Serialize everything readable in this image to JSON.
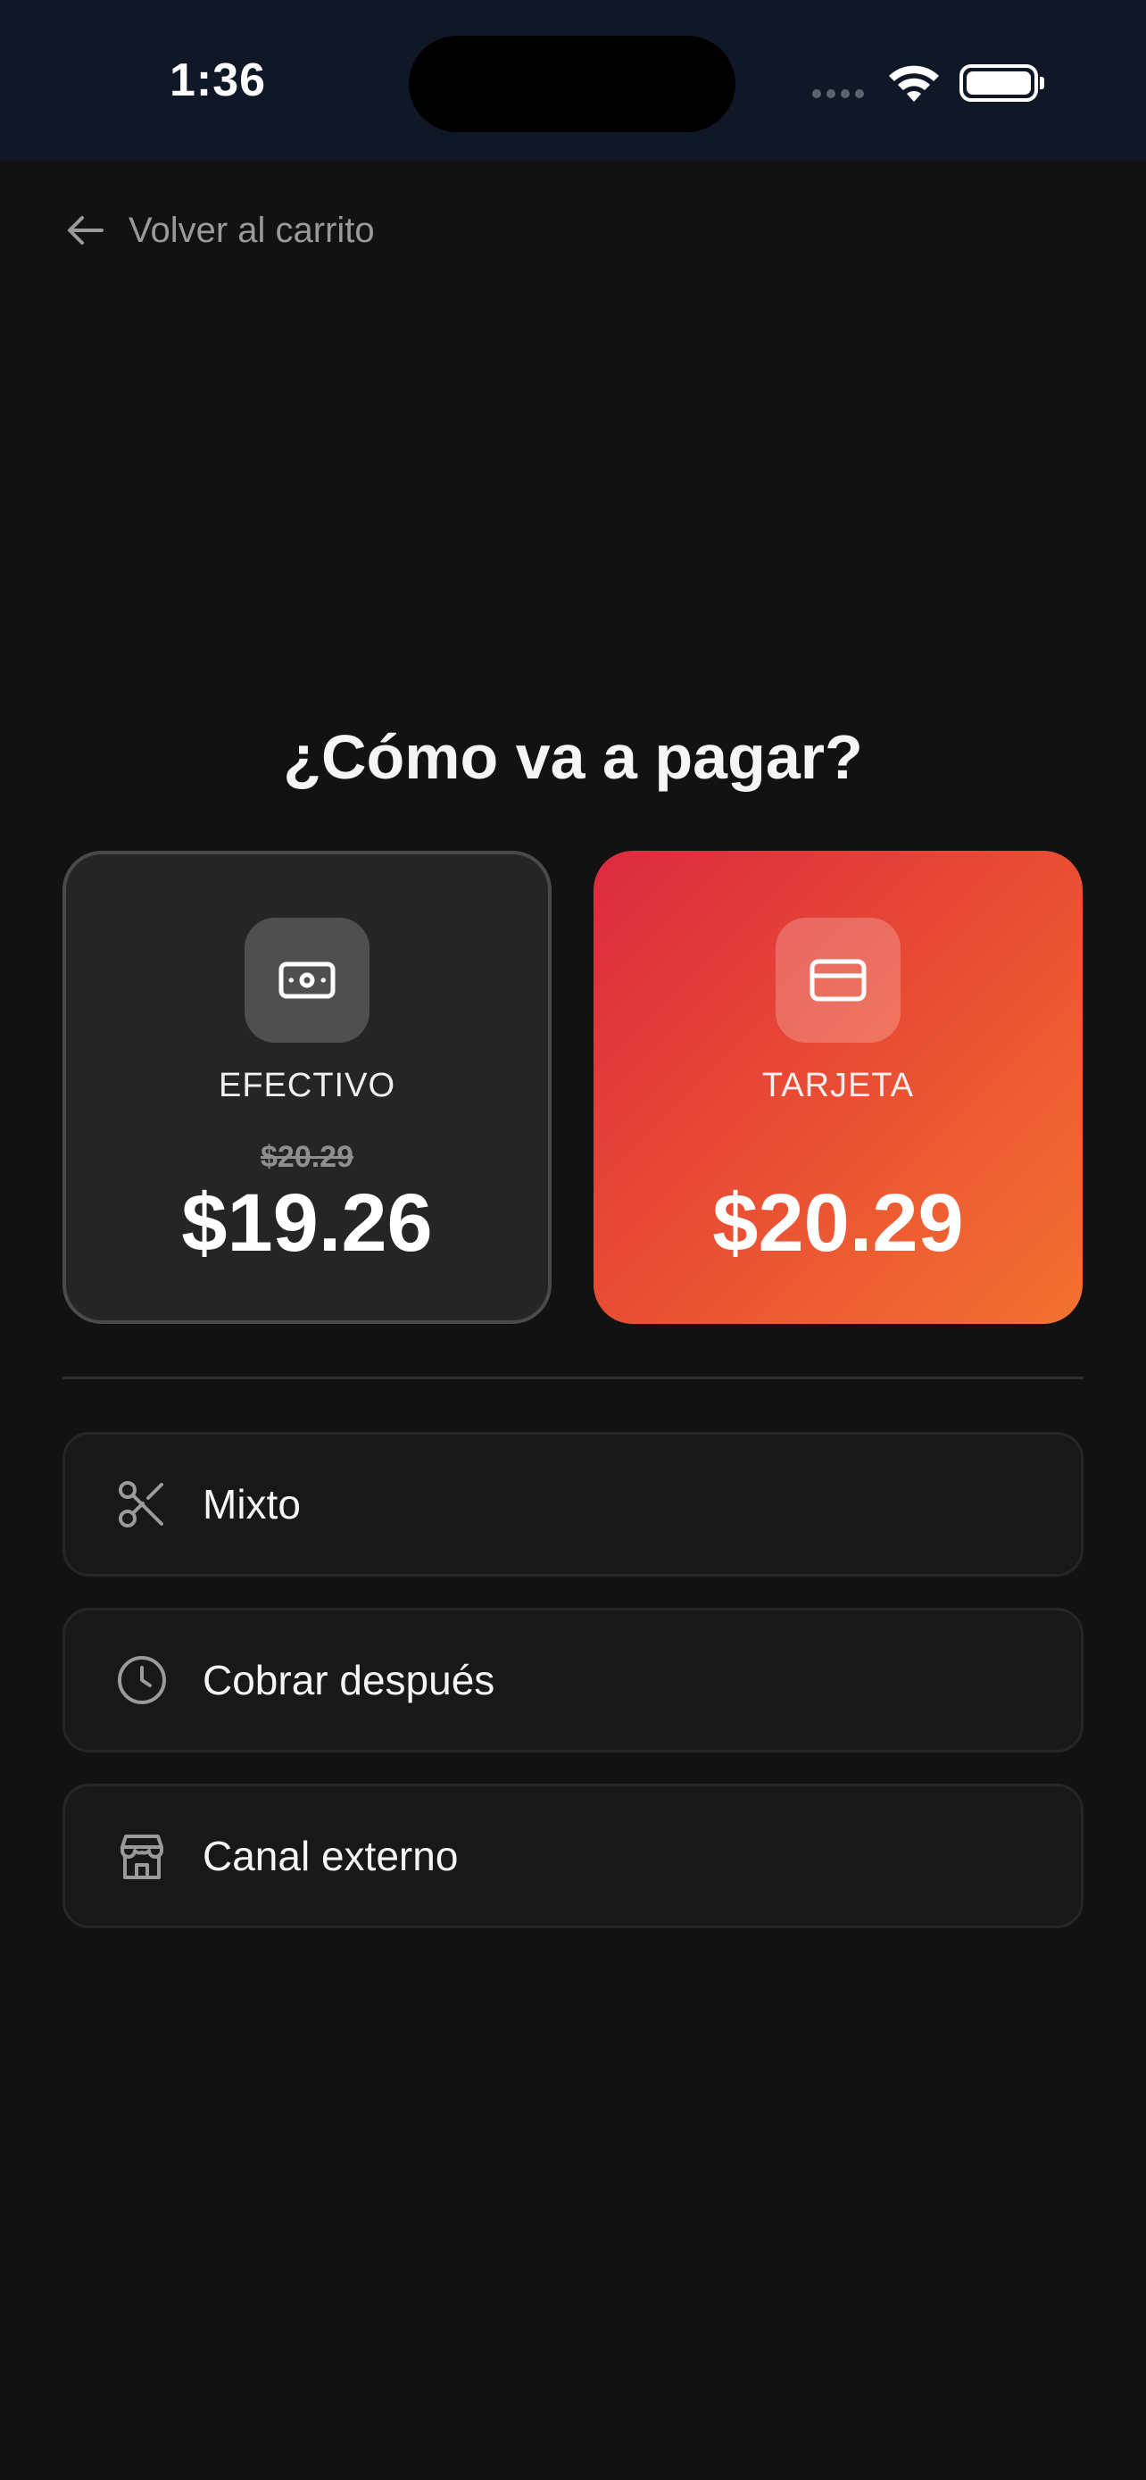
{
  "status_bar": {
    "time": "1:36"
  },
  "nav": {
    "back_label": "Volver al carrito"
  },
  "page": {
    "title": "¿Cómo va a pagar?"
  },
  "payment_methods": [
    {
      "label": "EFECTIVO",
      "original_price": "$20.29",
      "price": "$19.26",
      "icon": "cash-icon",
      "background": "#252525"
    },
    {
      "label": "TARJETA",
      "price": "$20.29",
      "icon": "credit-card-icon",
      "gradient": [
        "#dc2a40",
        "#f37230"
      ]
    }
  ],
  "options": [
    {
      "label": "Mixto",
      "icon": "scissors-icon"
    },
    {
      "label": "Cobrar después",
      "icon": "clock-icon"
    },
    {
      "label": "Canal externo",
      "icon": "store-icon"
    }
  ]
}
